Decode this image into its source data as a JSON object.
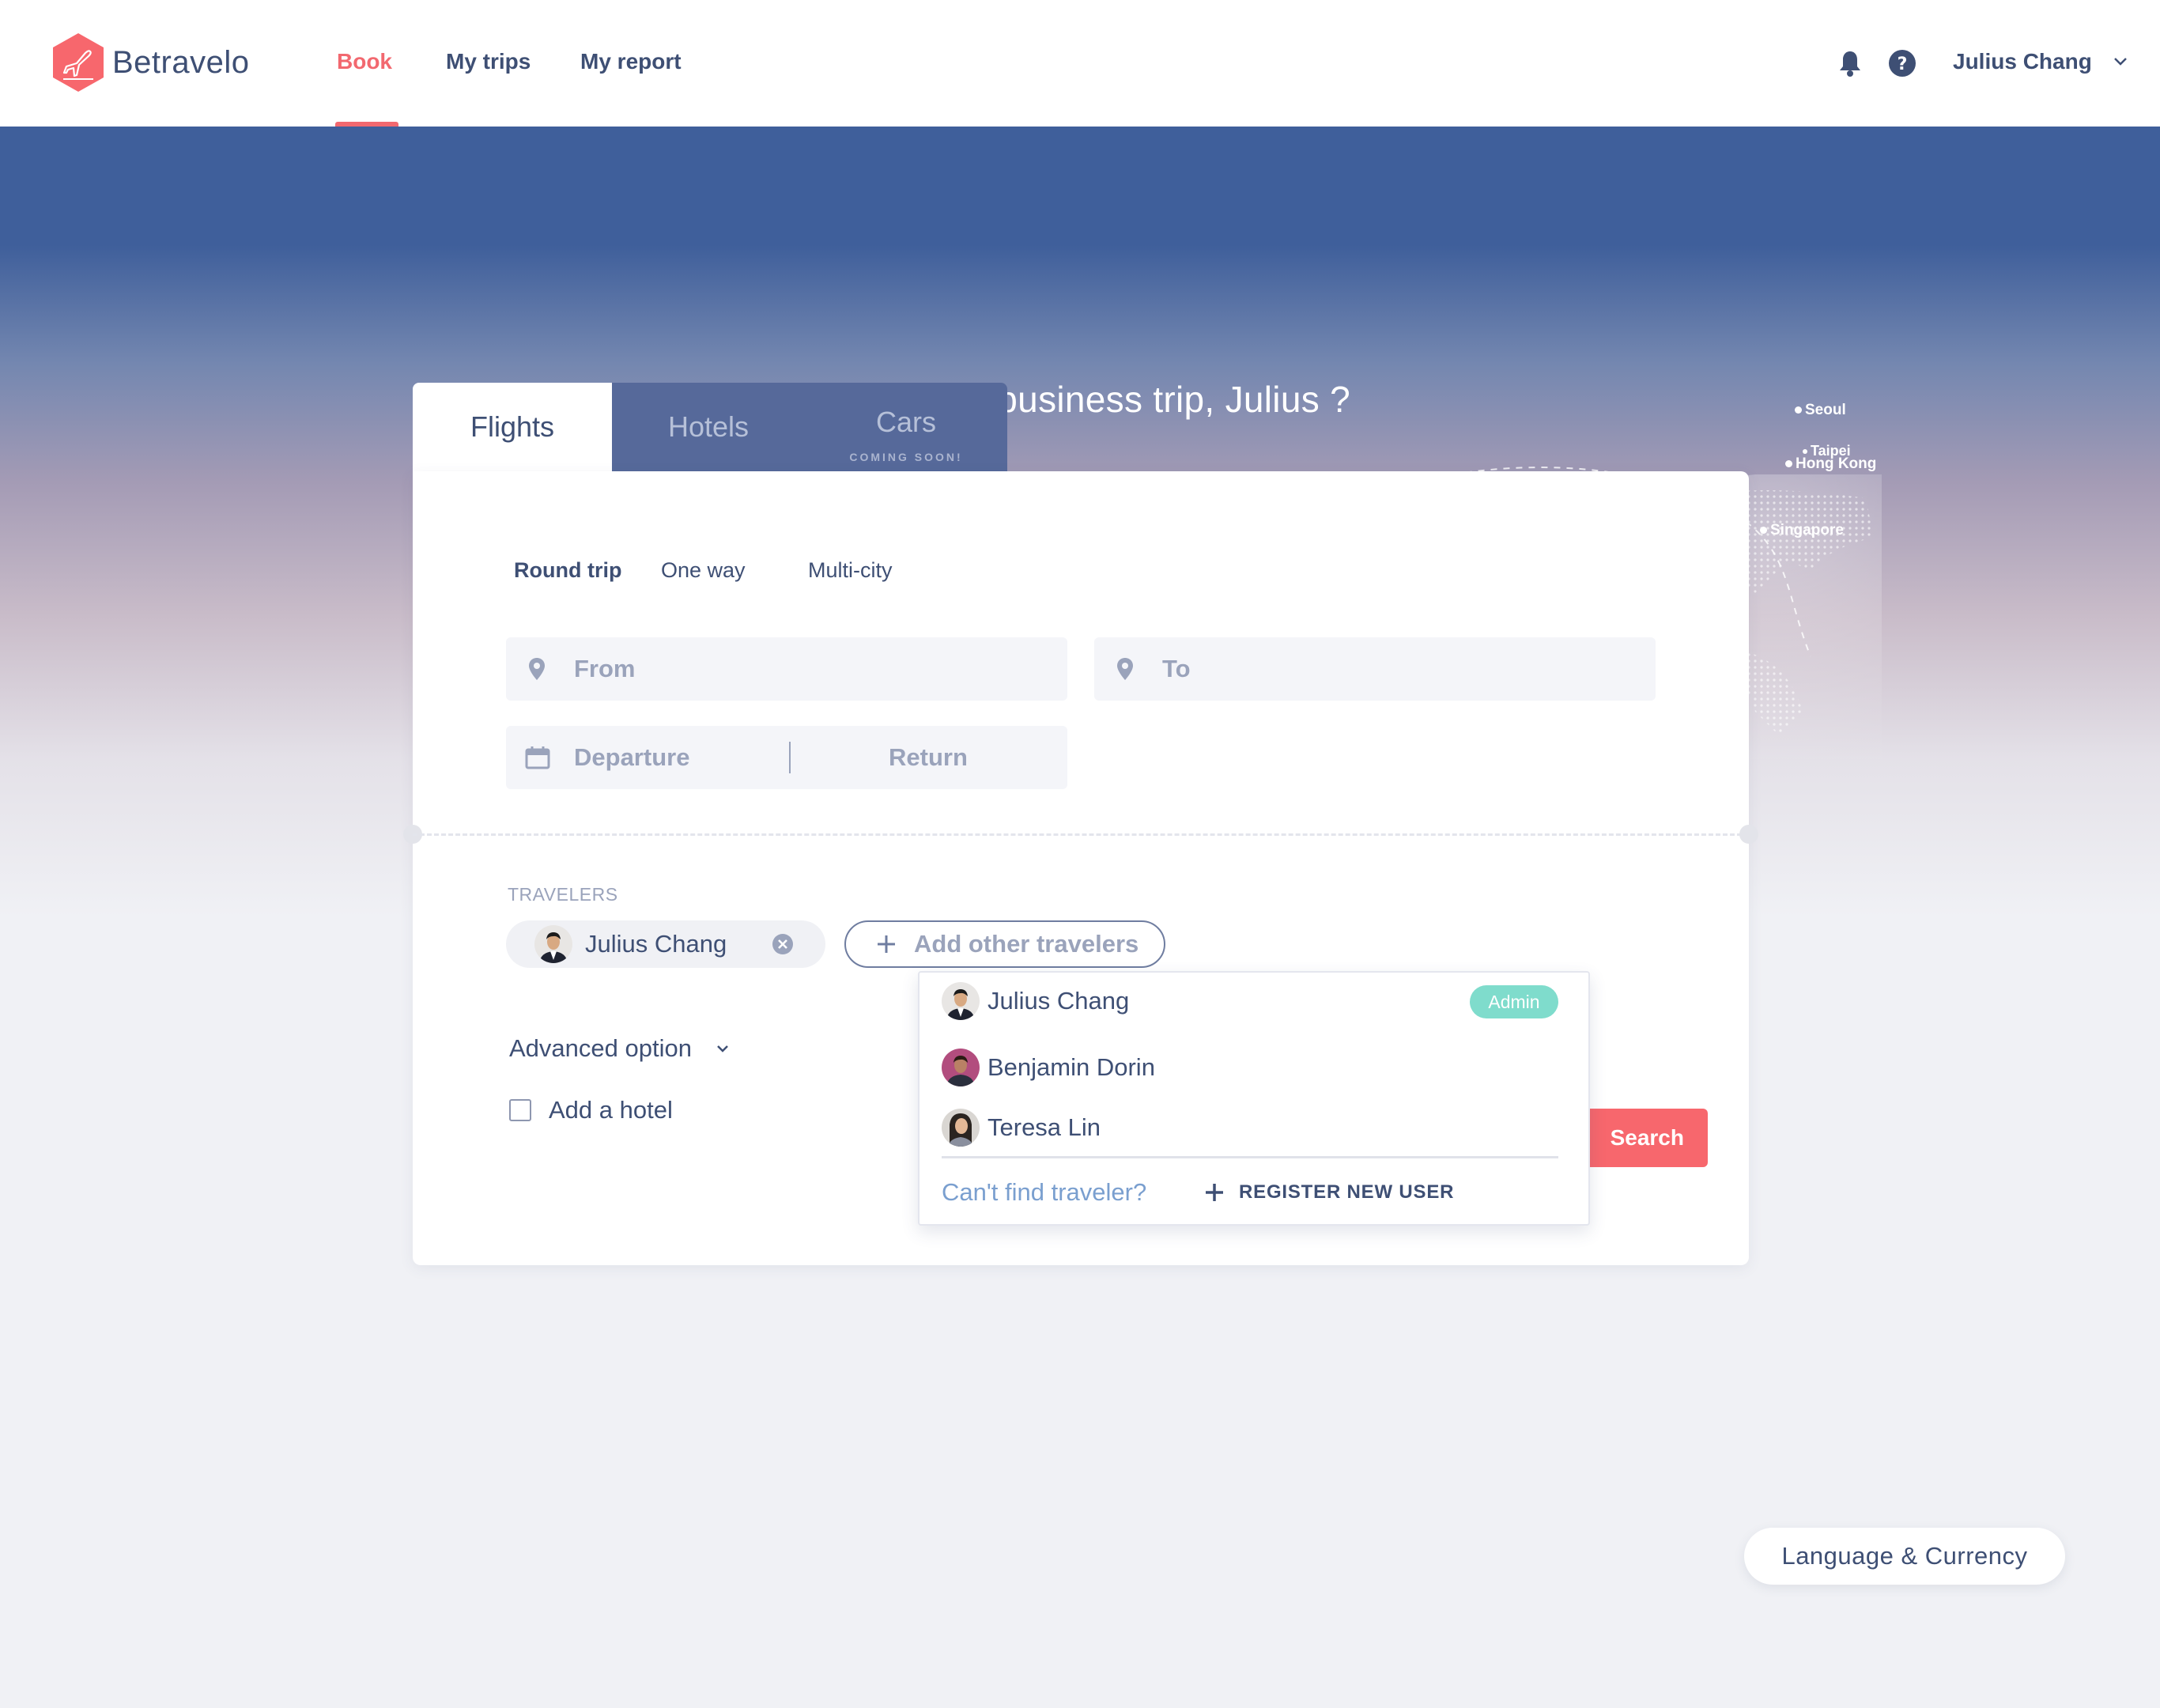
{
  "brand": {
    "name": "Betravelo",
    "color": "#f2686f"
  },
  "nav": {
    "items": [
      {
        "label": "Book",
        "active": true
      },
      {
        "label": "My trips",
        "active": false
      },
      {
        "label": "My report",
        "active": false
      }
    ]
  },
  "header": {
    "icons": [
      "bell-icon",
      "help-icon"
    ],
    "user_name": "Julius Chang"
  },
  "hero": {
    "title": "Need to book a business trip, Julius ?",
    "cities": [
      "Seoul",
      "Taipei",
      "Hong Kong",
      "Singapore"
    ]
  },
  "booking": {
    "tabs": [
      {
        "label": "Flights",
        "active": true
      },
      {
        "label": "Hotels",
        "active": false
      },
      {
        "label": "Cars",
        "active": false,
        "badge": "COMING SOON!"
      }
    ],
    "trip_types": [
      {
        "label": "Round trip",
        "active": true
      },
      {
        "label": "One way",
        "active": false
      },
      {
        "label": "Multi-city",
        "active": false
      }
    ],
    "from_placeholder": "From",
    "to_placeholder": "To",
    "departure_placeholder": "Departure",
    "return_placeholder": "Return",
    "travelers_label": "TRAVELERS",
    "selected_traveler": "Julius Chang",
    "add_travelers_label": "Add other travelers",
    "advanced_option_label": "Advanced option",
    "add_hotel_label": "Add a hotel",
    "add_hotel_checked": false,
    "search_button_label": "Search",
    "accent_color": "#f7676d"
  },
  "traveler_dropdown": {
    "items": [
      {
        "name": "Julius Chang",
        "badge": "Admin"
      },
      {
        "name": "Benjamin Dorin",
        "badge": ""
      },
      {
        "name": "Teresa Lin",
        "badge": ""
      }
    ],
    "cant_find_label": "Can't find traveler?",
    "register_label": "REGISTER NEW USER",
    "badge_color": "#7fdccc"
  },
  "footer": {
    "language_currency_label": "Language & Currency"
  }
}
